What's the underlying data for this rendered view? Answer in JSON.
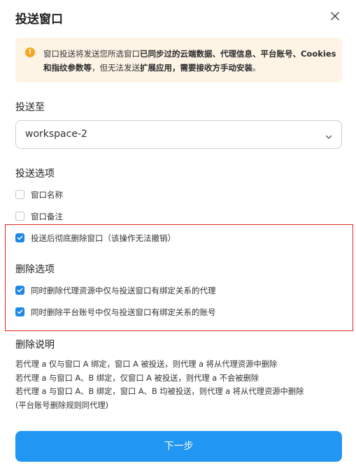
{
  "dialog": {
    "title": "投送窗口"
  },
  "notice": {
    "icon": "warning-icon",
    "text_parts": [
      "窗口投送将发送您所选窗口",
      "已同步过的云端数据、代理信息、平台账号、Cookies 和指纹参数等",
      "，但无法发送",
      "扩展应用，需要接收方手动安装",
      "。"
    ]
  },
  "send_to": {
    "label": "投送至",
    "selected": "workspace-2"
  },
  "send_options": {
    "label": "投送选项",
    "items": [
      {
        "label": "窗口名称",
        "checked": false
      },
      {
        "label": "窗口备注",
        "checked": false
      },
      {
        "label": "投送后彻底删除窗口（该操作无法撤销）",
        "checked": true
      }
    ]
  },
  "delete_options": {
    "label": "删除选项",
    "items": [
      {
        "label": "同时删除代理资源中仅与投送窗口有绑定关系的代理",
        "checked": true
      },
      {
        "label": "同时删除平台账号中仅与投送窗口有绑定关系的账号",
        "checked": true
      }
    ]
  },
  "delete_explain": {
    "label": "删除说明",
    "lines": [
      "若代理 a 仅与窗口 A 绑定，窗口 A 被投送，则代理 a 将从代理资源中删除",
      "若代理 a 与窗口 A、B 绑定，仅窗口 A 被投送，则代理 a 不会被删除",
      "若代理 a 与窗口 A、B 绑定，窗口 A、B 均被投送，则代理 a 将从代理资源中删除",
      "(平台账号删除规则同代理)"
    ]
  },
  "footer": {
    "next_label": "下一步"
  },
  "colors": {
    "accent": "#2196f3",
    "checkbox": "#1e88e5",
    "warning": "#f5a623",
    "notice_bg": "#fdf4e6",
    "highlight_border": "#e02424"
  }
}
